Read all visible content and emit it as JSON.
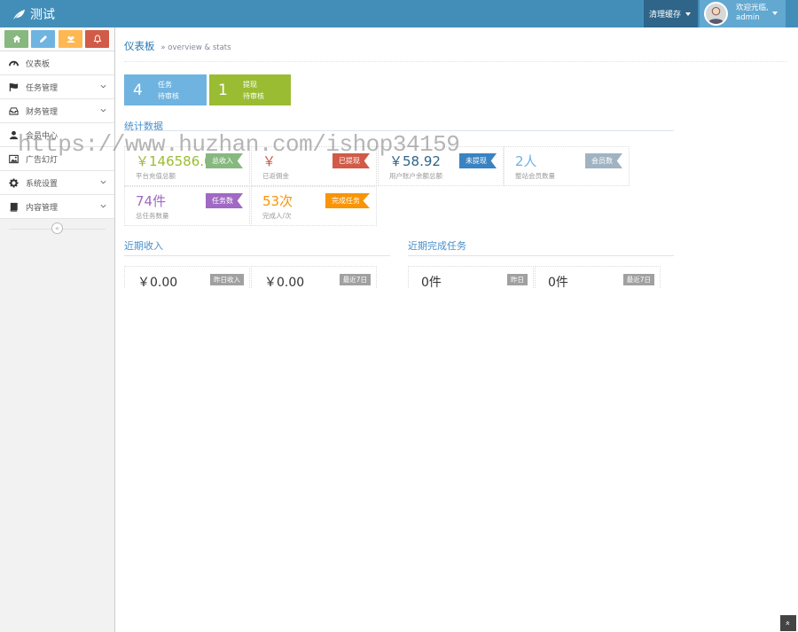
{
  "app": {
    "brand": "测试"
  },
  "topbar": {
    "clear_cache": "清理缓存",
    "welcome": "欢迎光临,",
    "username": "admin"
  },
  "sidebar": {
    "shortcut_colors": [
      "#87b87f",
      "#6fb3e0",
      "#ffb752",
      "#d15b47"
    ],
    "items": [
      {
        "label": "仪表板",
        "icon": "dashboard-icon",
        "has_arrow": false
      },
      {
        "label": "任务管理",
        "icon": "flag-icon",
        "has_arrow": true
      },
      {
        "label": "财务管理",
        "icon": "inbox-icon",
        "has_arrow": true
      },
      {
        "label": "会员中心",
        "icon": "user-icon",
        "has_arrow": false
      },
      {
        "label": "广告幻灯",
        "icon": "picture-icon",
        "has_arrow": false
      },
      {
        "label": "系统设置",
        "icon": "cog-icon",
        "has_arrow": true
      },
      {
        "label": "内容管理",
        "icon": "book-icon",
        "has_arrow": true
      }
    ]
  },
  "header": {
    "title": "仪表板",
    "subtitle": "» overview & stats"
  },
  "infoboxes": [
    {
      "num": "4",
      "line1": "任务",
      "line2": "待审核",
      "color": "#6fb3e0"
    },
    {
      "num": "1",
      "line1": "提现",
      "line2": "待审核",
      "color": "#9abc32"
    }
  ],
  "stats": {
    "title": "统计数据",
    "cards": [
      {
        "value": "￥146586.0",
        "desc": "平台充值总额",
        "tag": "总收入",
        "value_color": "#9abc32",
        "tag_color": "#87b87f"
      },
      {
        "value": "￥",
        "desc": "已返佣金",
        "tag": "已提现",
        "value_color": "#d15b47",
        "tag_color": "#d15b47"
      },
      {
        "value": "￥58.92",
        "desc": "用户账户余额总额",
        "tag": "未提现",
        "value_color": "#2e6589",
        "tag_color": "#3983c2"
      },
      {
        "value": "2人",
        "desc": "整站会员数量",
        "tag": "会员数",
        "value_color": "#6fb3e0",
        "tag_color": "#a0b3c2"
      },
      {
        "value": "74件",
        "desc": "总任务数量",
        "tag": "任务数",
        "value_color": "#a069c3",
        "tag_color": "#a069c3"
      },
      {
        "value": "53次",
        "desc": "完成人/次",
        "tag": "完成任务",
        "value_color": "#f89406",
        "tag_color": "#f89406"
      }
    ]
  },
  "income": {
    "title": "近期收入",
    "items": [
      {
        "value": "￥0.00",
        "tag": "昨日收入"
      },
      {
        "value": "￥0.00",
        "tag": "最近7日"
      }
    ]
  },
  "tasks": {
    "title": "近期完成任务",
    "items": [
      {
        "value": "0件",
        "tag": "昨日"
      },
      {
        "value": "0件",
        "tag": "最近7日"
      }
    ]
  },
  "watermark": "https://www.huzhan.com/ishop34159"
}
